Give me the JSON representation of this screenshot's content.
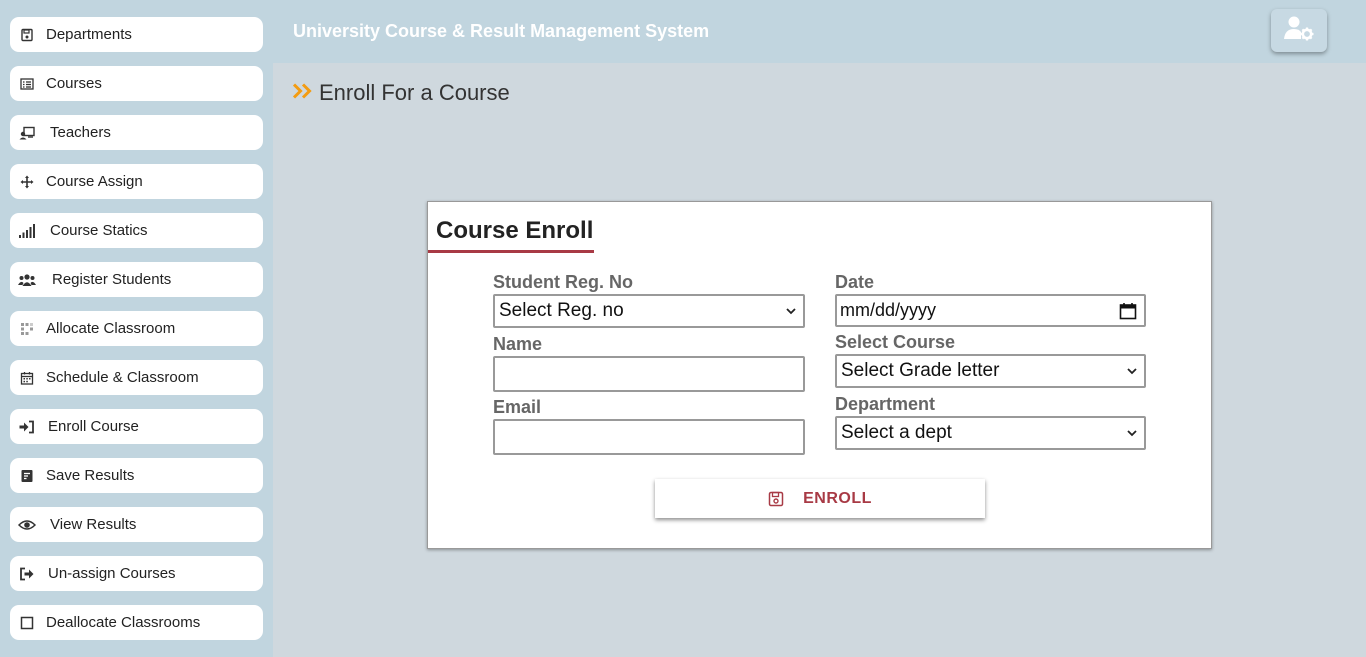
{
  "header": {
    "title": "University Course & Result Management System",
    "user_icon": "user-cog-icon"
  },
  "sidebar": {
    "items": [
      {
        "label": "Departments",
        "icon": "save-icon"
      },
      {
        "label": "Courses",
        "icon": "list-icon"
      },
      {
        "label": "Teachers",
        "icon": "chalkboard-teacher-icon"
      },
      {
        "label": "Course Assign",
        "icon": "arrows-move-icon"
      },
      {
        "label": "Course Statics",
        "icon": "signal-bars-icon"
      },
      {
        "label": "Register Students",
        "icon": "users-icon"
      },
      {
        "label": "Allocate Classroom",
        "icon": "grid-icon"
      },
      {
        "label": "Schedule & Classroom",
        "icon": "calendar-icon"
      },
      {
        "label": "Enroll Course",
        "icon": "sign-in-icon"
      },
      {
        "label": "Save Results",
        "icon": "document-icon"
      },
      {
        "label": "View Results",
        "icon": "eye-icon"
      },
      {
        "label": "Un-assign Courses",
        "icon": "sign-out-icon"
      },
      {
        "label": "Deallocate Classrooms",
        "icon": "square-icon"
      }
    ]
  },
  "page": {
    "heading": "Enroll For a Course",
    "heading_icon": "double-chevron-right-icon"
  },
  "form": {
    "title": "Course Enroll",
    "reg_no": {
      "label": "Student Reg. No",
      "value": "Select Reg. no"
    },
    "name": {
      "label": "Name",
      "value": ""
    },
    "email": {
      "label": "Email",
      "value": ""
    },
    "date": {
      "label": "Date",
      "placeholder": "mm/dd/yyyy"
    },
    "course": {
      "label": "Select Course",
      "value": "Select Grade letter"
    },
    "department": {
      "label": "Department",
      "value": "Select a dept"
    },
    "submit_label": "ENROLL",
    "submit_icon": "save-icon"
  },
  "colors": {
    "sidebar_bg": "#c1d5df",
    "page_bg": "#cfd8de",
    "accent_red": "#a83a45",
    "accent_orange": "#f39c12"
  }
}
